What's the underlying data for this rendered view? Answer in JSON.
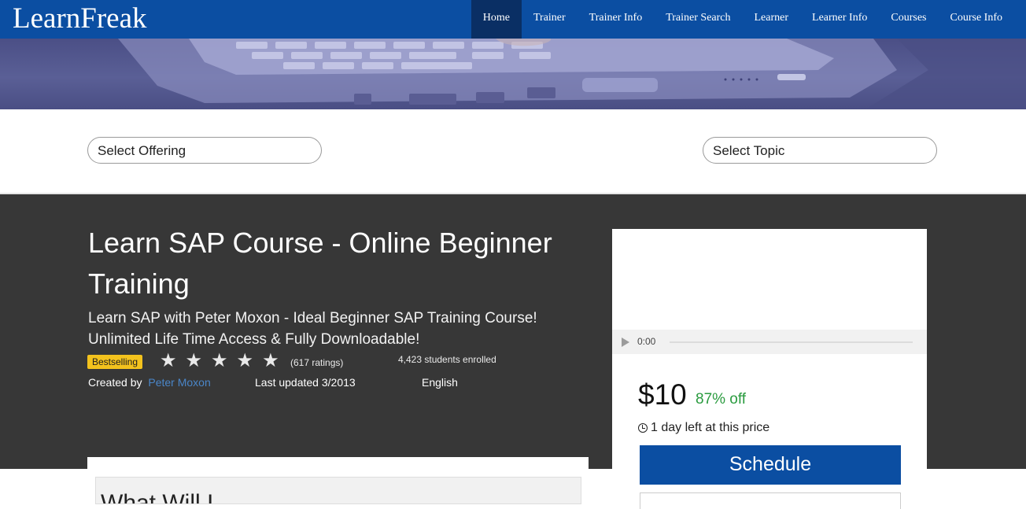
{
  "brand": "LearnFreak",
  "nav": {
    "items": [
      {
        "label": "Home",
        "active": true
      },
      {
        "label": "Trainer"
      },
      {
        "label": "Trainer Info"
      },
      {
        "label": "Trainer Search"
      },
      {
        "label": "Learner"
      },
      {
        "label": "Learner Info"
      },
      {
        "label": "Courses"
      },
      {
        "label": "Course Info"
      }
    ]
  },
  "filters": {
    "offering_label": "Select Offering",
    "topic_label": "Select Topic"
  },
  "course": {
    "title": "Learn SAP Course - Online Beginner Training",
    "subtitle": "Learn SAP with Peter Moxon - Ideal Beginner SAP Training Course! Unlimited Life Time Access & Fully Downloadable!",
    "badge": "Bestselling",
    "rating_stars": 5,
    "ratings_text": "(617 ratings)",
    "enrolled_text": "4,423 students enrolled",
    "created_by_label": "Created by",
    "creator_name": "Peter Moxon",
    "last_updated_label": "Last updated",
    "last_updated_value": "3/2013",
    "language": "English"
  },
  "content_section": {
    "heading_partial": "What Will I..."
  },
  "purchase": {
    "audio_time": "0:00",
    "price": "$10",
    "discount": "87% off",
    "deadline": "1 day left at this price",
    "schedule_label": "Schedule"
  },
  "colors": {
    "nav_bg": "#0b4ea2",
    "nav_active": "#0a2f64",
    "banner_bg": "#373737",
    "badge_bg": "#f3c21d",
    "discount": "#2a9b3f",
    "link": "#4a86c8"
  }
}
